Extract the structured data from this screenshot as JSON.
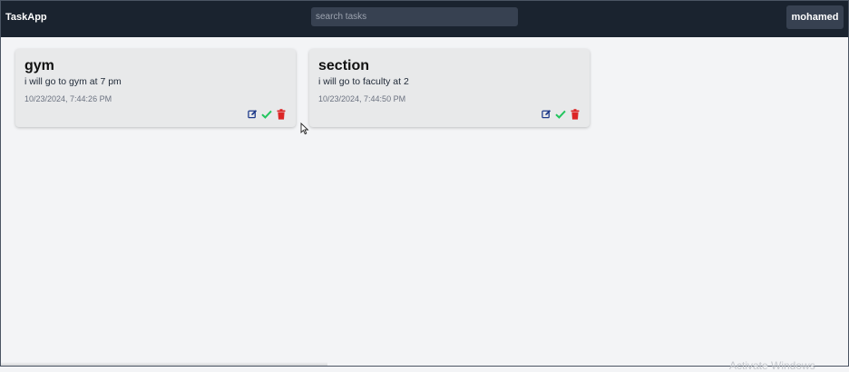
{
  "app": {
    "brand": "TaskApp",
    "search_placeholder": "search tasks",
    "user_name": "mohamed"
  },
  "tasks": [
    {
      "title": "gym",
      "description": "i will go to gym at 7 pm",
      "date": "10/23/2024, 7:44:26 PM"
    },
    {
      "title": "section",
      "description": "i will go to faculty at 2",
      "date": "10/23/2024, 7:44:50 PM"
    }
  ],
  "icons": {
    "edit": "edit-icon",
    "complete": "check-icon",
    "delete": "trash-icon"
  },
  "colors": {
    "navbar": "#1a232f",
    "edit": "#1e3a8a",
    "complete": "#22c55e",
    "delete": "#dc2626"
  },
  "watermark": "Activate Windows"
}
